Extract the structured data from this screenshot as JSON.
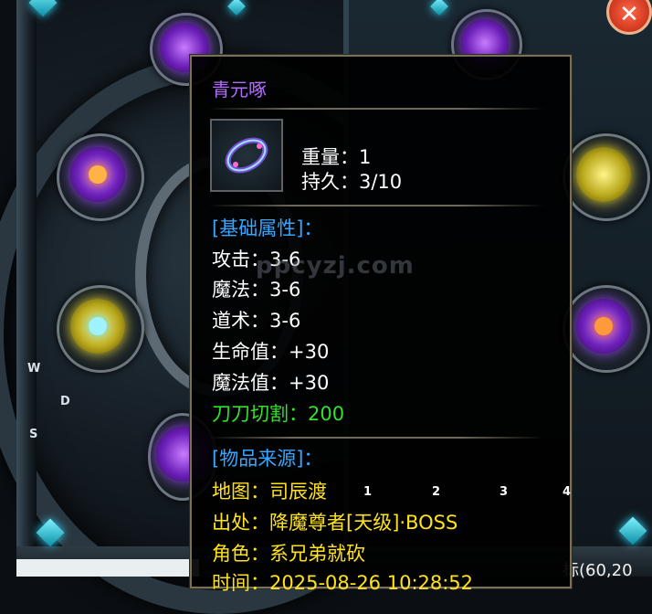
{
  "item": {
    "name": "青元啄",
    "weight": "重量：1",
    "durability": "持久：3/10",
    "basic_header": "[基础属性]：",
    "attributes": [
      "攻击：3-6",
      "魔法：3-6",
      "道术：3-6",
      "生命值：+30",
      "魔法值：+30"
    ],
    "special": "刀刀切割：200",
    "source_header": "[物品来源]：",
    "source": {
      "map": "地图：司辰渡",
      "origin": "出处：降魔尊者[天级]·BOSS",
      "role": "角色：系兄弟就砍",
      "time": "时间：2025-08-26 10:28:52"
    }
  },
  "compass": {
    "w": "W",
    "d": "D",
    "s": "S"
  },
  "slot_numbers": [
    "1",
    "2",
    "3",
    "4"
  ],
  "watermark": "ppcyzj.com",
  "coordinate_text": "标(60,20",
  "close_label": "✕",
  "colors": {
    "title": "#b26cff",
    "header": "#37a6ff",
    "special": "#33e02a",
    "source": "#ffe21a",
    "border": "#7a7058"
  }
}
